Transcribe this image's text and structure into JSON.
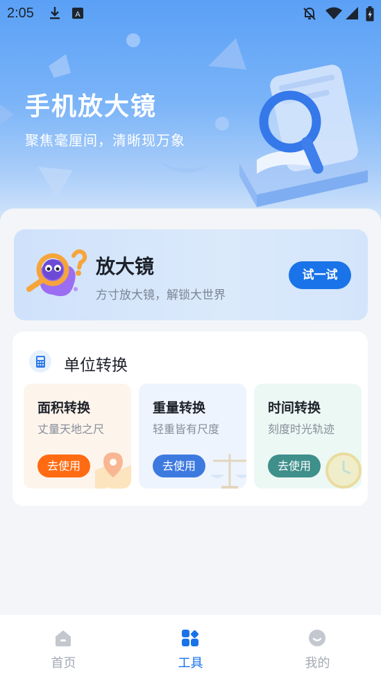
{
  "status_bar": {
    "time": "2:05",
    "left_icons": [
      "download-icon",
      "app-notification-icon"
    ],
    "right_icons": [
      "notifications-off-icon",
      "wifi-icon",
      "signal-icon",
      "battery-icon"
    ]
  },
  "hero": {
    "title": "手机放大镜",
    "subtitle": "聚焦毫厘间，清晰现万象"
  },
  "magnifier_card": {
    "title": "放大镜",
    "subtitle": "方寸放大镜，解锁大世界",
    "button_label": "试一试"
  },
  "unit_conversion": {
    "title": "单位转换",
    "tiles": [
      {
        "title": "面积转换",
        "subtitle": "丈量天地之尺",
        "button_label": "去使用",
        "button_color": "#ff6b12",
        "bg": "#fdf4ec",
        "icon": "map-pin-icon"
      },
      {
        "title": "重量转换",
        "subtitle": "轻重皆有尺度",
        "button_label": "去使用",
        "button_color": "#3d7ae0",
        "bg": "#eef4fd",
        "icon": "scale-icon"
      },
      {
        "title": "时间转换",
        "subtitle": "刻度时光轨迹",
        "button_label": "去使用",
        "button_color": "#3f8f8b",
        "bg": "#ecf8f4",
        "icon": "clock-icon"
      }
    ]
  },
  "tab_bar": {
    "tabs": [
      {
        "label": "首页",
        "icon": "home-icon",
        "active": false
      },
      {
        "label": "工具",
        "icon": "tools-grid-icon",
        "active": true
      },
      {
        "label": "我的",
        "icon": "profile-icon",
        "active": false
      }
    ]
  },
  "colors": {
    "accent": "#1a73e8",
    "tab_active": "#1a73e8",
    "tab_inactive": "#a3a9b3"
  }
}
